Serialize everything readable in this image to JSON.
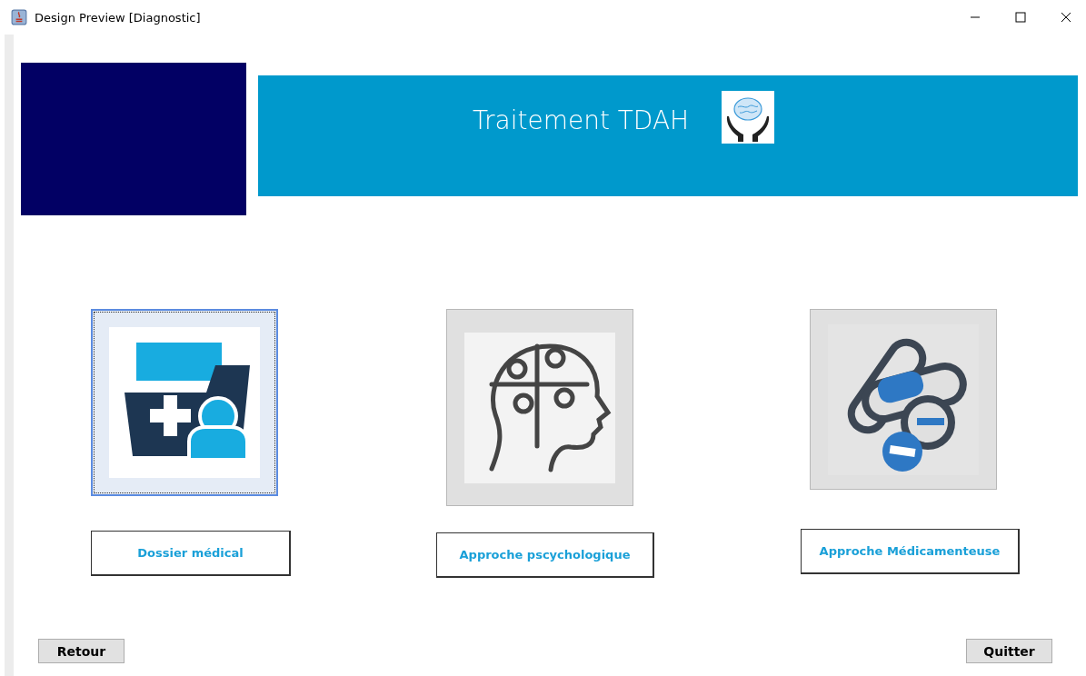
{
  "window": {
    "title": "Design Preview [Diagnostic]"
  },
  "header": {
    "title": "Traitement TDAH"
  },
  "options": [
    {
      "kind": "folder",
      "focused": true,
      "label": "Dossier médical"
    },
    {
      "kind": "head",
      "focused": false,
      "label": "Approche pscychologique"
    },
    {
      "kind": "pills",
      "focused": false,
      "label": "Approche Médicamenteuse"
    }
  ],
  "buttons": {
    "back": "Retour",
    "quit": "Quitter"
  }
}
